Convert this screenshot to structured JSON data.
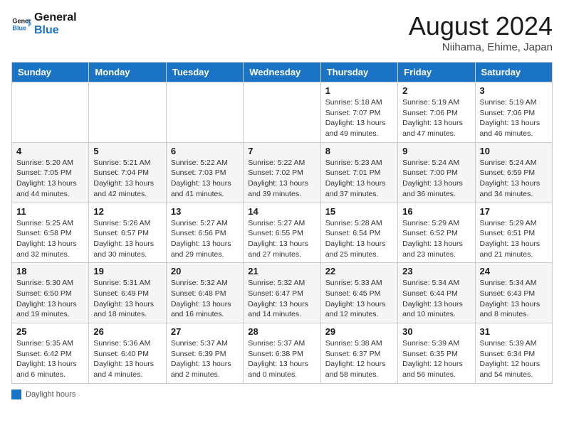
{
  "header": {
    "logo_line1": "General",
    "logo_line2": "Blue",
    "month_title": "August 2024",
    "location": "Niihama, Ehime, Japan"
  },
  "days_of_week": [
    "Sunday",
    "Monday",
    "Tuesday",
    "Wednesday",
    "Thursday",
    "Friday",
    "Saturday"
  ],
  "weeks": [
    [
      {
        "day": "",
        "detail": ""
      },
      {
        "day": "",
        "detail": ""
      },
      {
        "day": "",
        "detail": ""
      },
      {
        "day": "",
        "detail": ""
      },
      {
        "day": "1",
        "detail": "Sunrise: 5:18 AM\nSunset: 7:07 PM\nDaylight: 13 hours and 49 minutes."
      },
      {
        "day": "2",
        "detail": "Sunrise: 5:19 AM\nSunset: 7:06 PM\nDaylight: 13 hours and 47 minutes."
      },
      {
        "day": "3",
        "detail": "Sunrise: 5:19 AM\nSunset: 7:06 PM\nDaylight: 13 hours and 46 minutes."
      }
    ],
    [
      {
        "day": "4",
        "detail": "Sunrise: 5:20 AM\nSunset: 7:05 PM\nDaylight: 13 hours and 44 minutes."
      },
      {
        "day": "5",
        "detail": "Sunrise: 5:21 AM\nSunset: 7:04 PM\nDaylight: 13 hours and 42 minutes."
      },
      {
        "day": "6",
        "detail": "Sunrise: 5:22 AM\nSunset: 7:03 PM\nDaylight: 13 hours and 41 minutes."
      },
      {
        "day": "7",
        "detail": "Sunrise: 5:22 AM\nSunset: 7:02 PM\nDaylight: 13 hours and 39 minutes."
      },
      {
        "day": "8",
        "detail": "Sunrise: 5:23 AM\nSunset: 7:01 PM\nDaylight: 13 hours and 37 minutes."
      },
      {
        "day": "9",
        "detail": "Sunrise: 5:24 AM\nSunset: 7:00 PM\nDaylight: 13 hours and 36 minutes."
      },
      {
        "day": "10",
        "detail": "Sunrise: 5:24 AM\nSunset: 6:59 PM\nDaylight: 13 hours and 34 minutes."
      }
    ],
    [
      {
        "day": "11",
        "detail": "Sunrise: 5:25 AM\nSunset: 6:58 PM\nDaylight: 13 hours and 32 minutes."
      },
      {
        "day": "12",
        "detail": "Sunrise: 5:26 AM\nSunset: 6:57 PM\nDaylight: 13 hours and 30 minutes."
      },
      {
        "day": "13",
        "detail": "Sunrise: 5:27 AM\nSunset: 6:56 PM\nDaylight: 13 hours and 29 minutes."
      },
      {
        "day": "14",
        "detail": "Sunrise: 5:27 AM\nSunset: 6:55 PM\nDaylight: 13 hours and 27 minutes."
      },
      {
        "day": "15",
        "detail": "Sunrise: 5:28 AM\nSunset: 6:54 PM\nDaylight: 13 hours and 25 minutes."
      },
      {
        "day": "16",
        "detail": "Sunrise: 5:29 AM\nSunset: 6:52 PM\nDaylight: 13 hours and 23 minutes."
      },
      {
        "day": "17",
        "detail": "Sunrise: 5:29 AM\nSunset: 6:51 PM\nDaylight: 13 hours and 21 minutes."
      }
    ],
    [
      {
        "day": "18",
        "detail": "Sunrise: 5:30 AM\nSunset: 6:50 PM\nDaylight: 13 hours and 19 minutes."
      },
      {
        "day": "19",
        "detail": "Sunrise: 5:31 AM\nSunset: 6:49 PM\nDaylight: 13 hours and 18 minutes."
      },
      {
        "day": "20",
        "detail": "Sunrise: 5:32 AM\nSunset: 6:48 PM\nDaylight: 13 hours and 16 minutes."
      },
      {
        "day": "21",
        "detail": "Sunrise: 5:32 AM\nSunset: 6:47 PM\nDaylight: 13 hours and 14 minutes."
      },
      {
        "day": "22",
        "detail": "Sunrise: 5:33 AM\nSunset: 6:45 PM\nDaylight: 13 hours and 12 minutes."
      },
      {
        "day": "23",
        "detail": "Sunrise: 5:34 AM\nSunset: 6:44 PM\nDaylight: 13 hours and 10 minutes."
      },
      {
        "day": "24",
        "detail": "Sunrise: 5:34 AM\nSunset: 6:43 PM\nDaylight: 13 hours and 8 minutes."
      }
    ],
    [
      {
        "day": "25",
        "detail": "Sunrise: 5:35 AM\nSunset: 6:42 PM\nDaylight: 13 hours and 6 minutes."
      },
      {
        "day": "26",
        "detail": "Sunrise: 5:36 AM\nSunset: 6:40 PM\nDaylight: 13 hours and 4 minutes."
      },
      {
        "day": "27",
        "detail": "Sunrise: 5:37 AM\nSunset: 6:39 PM\nDaylight: 13 hours and 2 minutes."
      },
      {
        "day": "28",
        "detail": "Sunrise: 5:37 AM\nSunset: 6:38 PM\nDaylight: 13 hours and 0 minutes."
      },
      {
        "day": "29",
        "detail": "Sunrise: 5:38 AM\nSunset: 6:37 PM\nDaylight: 12 hours and 58 minutes."
      },
      {
        "day": "30",
        "detail": "Sunrise: 5:39 AM\nSunset: 6:35 PM\nDaylight: 12 hours and 56 minutes."
      },
      {
        "day": "31",
        "detail": "Sunrise: 5:39 AM\nSunset: 6:34 PM\nDaylight: 12 hours and 54 minutes."
      }
    ]
  ],
  "footer": {
    "icon_label": "Daylight hours"
  }
}
